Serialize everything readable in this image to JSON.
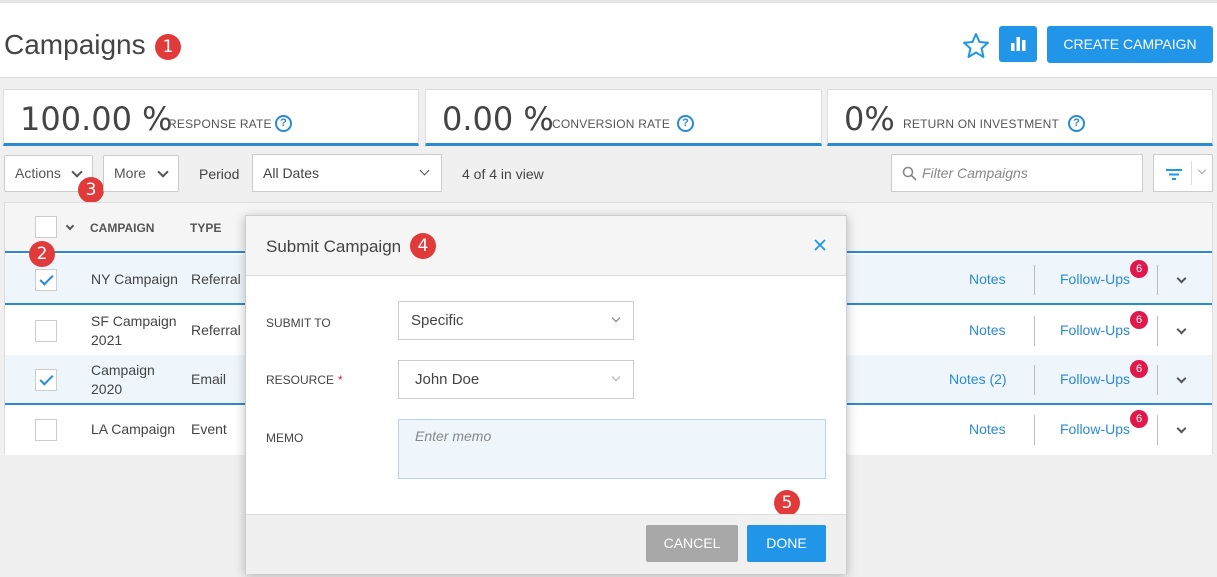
{
  "page": {
    "title": "Campaigns"
  },
  "callouts": [
    "1",
    "2",
    "3",
    "4",
    "5"
  ],
  "header": {
    "create_label": "CREATE CAMPAIGN"
  },
  "stats": [
    {
      "value": "100.00 %",
      "label": "RESPONSE RATE"
    },
    {
      "value": "0.00 %",
      "label": "CONVERSION RATE"
    },
    {
      "value": "0%",
      "label": "RETURN ON INVESTMENT"
    }
  ],
  "help_glyph": "?",
  "toolbar": {
    "actions_label": "Actions",
    "more_label": "More",
    "period_label": "Period",
    "period_value": "All Dates",
    "view_count": "4 of 4 in view",
    "filter_placeholder": "Filter Campaigns"
  },
  "table": {
    "columns": [
      "CAMPAIGN",
      "TYPE"
    ],
    "rows": [
      {
        "name": "NY Campaign",
        "type": "Referral",
        "notes": "Notes",
        "followups": "Follow-Ups",
        "badge": "6",
        "checked": true
      },
      {
        "name": "SF Campaign 2021",
        "type": "Referral",
        "notes": "Notes",
        "followups": "Follow-Ups",
        "badge": "6",
        "checked": false
      },
      {
        "name": "Campaign 2020",
        "type": "Email",
        "notes": "Notes (2)",
        "followups": "Follow-Ups",
        "badge": "6",
        "checked": true
      },
      {
        "name": "LA Campaign",
        "type": "Event",
        "notes": "Notes",
        "followups": "Follow-Ups",
        "badge": "6",
        "checked": false
      }
    ]
  },
  "modal": {
    "title": "Submit Campaign",
    "submit_to_label": "SUBMIT TO",
    "submit_to_value": "Specific",
    "resource_label": "RESOURCE",
    "required_mark": "*",
    "resource_value": "John Doe",
    "memo_label": "MEMO",
    "memo_placeholder": "Enter memo",
    "cancel_label": "CANCEL",
    "done_label": "DONE"
  },
  "colors": {
    "accent": "#2196e8",
    "callout": "#e03a3a",
    "badge": "#e0194d",
    "link": "#2a8ad4"
  }
}
